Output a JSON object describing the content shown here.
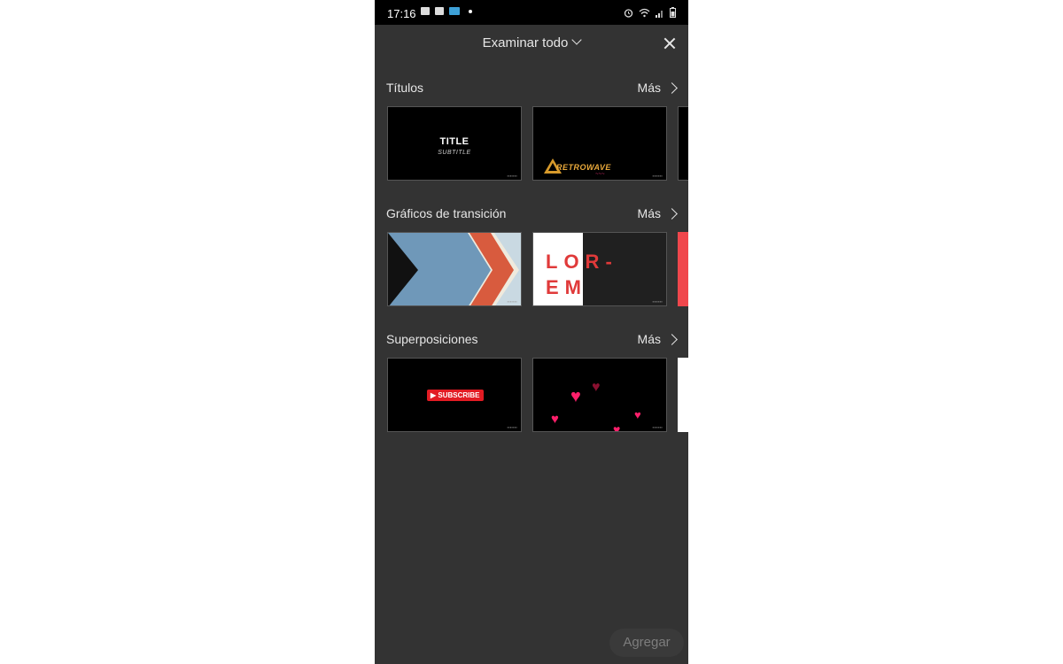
{
  "status_bar": {
    "time": "17:16"
  },
  "header": {
    "title": "Examinar todo"
  },
  "sections": [
    {
      "title": "Títulos",
      "more_label": "Más",
      "cards": [
        {
          "main_text": "TITLE",
          "sub_text": "SUBTITLE"
        },
        {
          "main_text": "RETROWAVE"
        }
      ]
    },
    {
      "title": "Gráficos de transición",
      "more_label": "Más",
      "cards": [
        {
          "main_text": ""
        },
        {
          "main_text": "LOR-EM"
        }
      ]
    },
    {
      "title": "Superposiciones",
      "more_label": "Más",
      "cards": [
        {
          "main_text": "SUBSCRIBE"
        },
        {
          "main_text": ""
        }
      ]
    }
  ],
  "footer": {
    "add_label": "Agregar"
  },
  "colors": {
    "panel_bg": "#333333",
    "status_bar_bg": "#000000",
    "text_light": "#e6e6e6",
    "accent_red": "#e03a3a",
    "heart_pink": "#ff1f6b"
  }
}
